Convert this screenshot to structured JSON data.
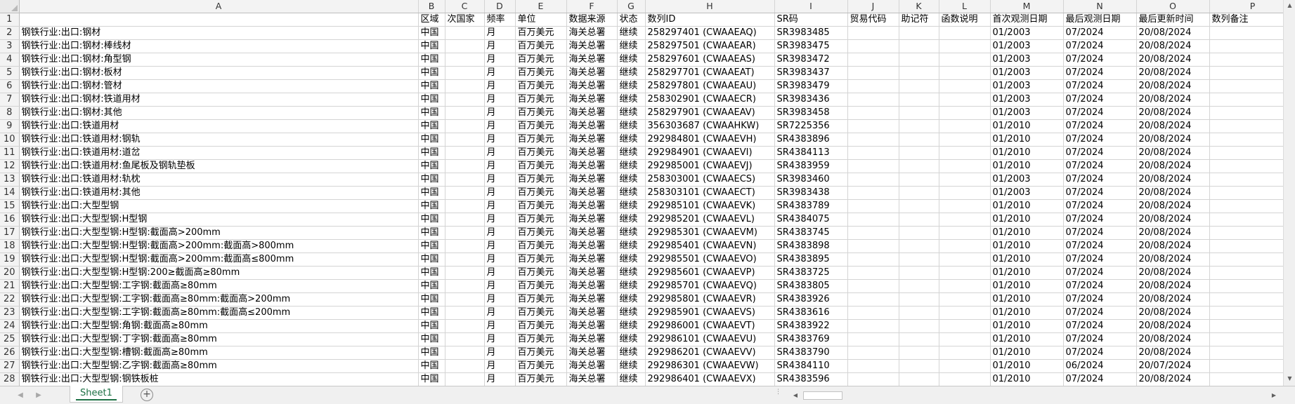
{
  "sheet": {
    "columns": [
      "A",
      "B",
      "C",
      "D",
      "E",
      "F",
      "G",
      "H",
      "I",
      "J",
      "K",
      "L",
      "M",
      "N",
      "O",
      "P"
    ],
    "row_numbers": [
      "1",
      "2",
      "3",
      "4",
      "5",
      "6",
      "7",
      "8",
      "9",
      "10",
      "11",
      "12",
      "13",
      "14",
      "15",
      "16",
      "17",
      "18",
      "19",
      "20",
      "21",
      "22",
      "23",
      "24",
      "25",
      "26",
      "27",
      "28"
    ],
    "rows": [
      [
        "",
        "区域",
        "次国家",
        "频率",
        "单位",
        "数据来源",
        "状态",
        "数列ID",
        "SR码",
        "贸易代码",
        "助记符",
        "函数说明",
        "首次观测日期",
        "最后观测日期",
        "最后更新时间",
        "数列备注"
      ],
      [
        "钢铁行业:出口:钢材",
        "中国",
        "",
        "月",
        "百万美元",
        "海关总署",
        "继续",
        "258297401 (CWAAEAQ)",
        "SR3983485",
        "",
        "",
        "",
        "01/2003",
        "07/2024",
        "20/08/2024",
        ""
      ],
      [
        "钢铁行业:出口:钢材:棒线材",
        "中国",
        "",
        "月",
        "百万美元",
        "海关总署",
        "继续",
        "258297501 (CWAAEAR)",
        "SR3983475",
        "",
        "",
        "",
        "01/2003",
        "07/2024",
        "20/08/2024",
        ""
      ],
      [
        "钢铁行业:出口:钢材:角型钢",
        "中国",
        "",
        "月",
        "百万美元",
        "海关总署",
        "继续",
        "258297601 (CWAAEAS)",
        "SR3983472",
        "",
        "",
        "",
        "01/2003",
        "07/2024",
        "20/08/2024",
        ""
      ],
      [
        "钢铁行业:出口:钢材:板材",
        "中国",
        "",
        "月",
        "百万美元",
        "海关总署",
        "继续",
        "258297701 (CWAAEAT)",
        "SR3983437",
        "",
        "",
        "",
        "01/2003",
        "07/2024",
        "20/08/2024",
        ""
      ],
      [
        "钢铁行业:出口:钢材:管材",
        "中国",
        "",
        "月",
        "百万美元",
        "海关总署",
        "继续",
        "258297801 (CWAAEAU)",
        "SR3983479",
        "",
        "",
        "",
        "01/2003",
        "07/2024",
        "20/08/2024",
        ""
      ],
      [
        "钢铁行业:出口:钢材:铁道用材",
        "中国",
        "",
        "月",
        "百万美元",
        "海关总署",
        "继续",
        "258302901 (CWAAECR)",
        "SR3983436",
        "",
        "",
        "",
        "01/2003",
        "07/2024",
        "20/08/2024",
        ""
      ],
      [
        "钢铁行业:出口:钢材:其他",
        "中国",
        "",
        "月",
        "百万美元",
        "海关总署",
        "继续",
        "258297901 (CWAAEAV)",
        "SR3983458",
        "",
        "",
        "",
        "01/2003",
        "07/2024",
        "20/08/2024",
        ""
      ],
      [
        "钢铁行业:出口:铁道用材",
        "中国",
        "",
        "月",
        "百万美元",
        "海关总署",
        "继续",
        "356303687 (CWAAHKW)",
        "SR7225356",
        "",
        "",
        "",
        "01/2010",
        "07/2024",
        "20/08/2024",
        ""
      ],
      [
        "钢铁行业:出口:铁道用材:钢轨",
        "中国",
        "",
        "月",
        "百万美元",
        "海关总署",
        "继续",
        "292984801 (CWAAEVH)",
        "SR4383896",
        "",
        "",
        "",
        "01/2010",
        "07/2024",
        "20/08/2024",
        ""
      ],
      [
        "钢铁行业:出口:铁道用材:道岔",
        "中国",
        "",
        "月",
        "百万美元",
        "海关总署",
        "继续",
        "292984901 (CWAAEVI)",
        "SR4384113",
        "",
        "",
        "",
        "01/2010",
        "07/2024",
        "20/08/2024",
        ""
      ],
      [
        "钢铁行业:出口:铁道用材:鱼尾板及钢轨垫板",
        "中国",
        "",
        "月",
        "百万美元",
        "海关总署",
        "继续",
        "292985001 (CWAAEVJ)",
        "SR4383959",
        "",
        "",
        "",
        "01/2010",
        "07/2024",
        "20/08/2024",
        ""
      ],
      [
        "钢铁行业:出口:铁道用材:轨枕",
        "中国",
        "",
        "月",
        "百万美元",
        "海关总署",
        "继续",
        "258303001 (CWAAECS)",
        "SR3983460",
        "",
        "",
        "",
        "01/2003",
        "07/2024",
        "20/08/2024",
        ""
      ],
      [
        "钢铁行业:出口:铁道用材:其他",
        "中国",
        "",
        "月",
        "百万美元",
        "海关总署",
        "继续",
        "258303101 (CWAAECT)",
        "SR3983438",
        "",
        "",
        "",
        "01/2003",
        "07/2024",
        "20/08/2024",
        ""
      ],
      [
        "钢铁行业:出口:大型型钢",
        "中国",
        "",
        "月",
        "百万美元",
        "海关总署",
        "继续",
        "292985101 (CWAAEVK)",
        "SR4383789",
        "",
        "",
        "",
        "01/2010",
        "07/2024",
        "20/08/2024",
        ""
      ],
      [
        "钢铁行业:出口:大型型钢:H型钢",
        "中国",
        "",
        "月",
        "百万美元",
        "海关总署",
        "继续",
        "292985201 (CWAAEVL)",
        "SR4384075",
        "",
        "",
        "",
        "01/2010",
        "07/2024",
        "20/08/2024",
        ""
      ],
      [
        "钢铁行业:出口:大型型钢:H型钢:截面高>200mm",
        "中国",
        "",
        "月",
        "百万美元",
        "海关总署",
        "继续",
        "292985301 (CWAAEVM)",
        "SR4383745",
        "",
        "",
        "",
        "01/2010",
        "07/2024",
        "20/08/2024",
        ""
      ],
      [
        "钢铁行业:出口:大型型钢:H型钢:截面高>200mm:截面高>800mm",
        "中国",
        "",
        "月",
        "百万美元",
        "海关总署",
        "继续",
        "292985401 (CWAAEVN)",
        "SR4383898",
        "",
        "",
        "",
        "01/2010",
        "07/2024",
        "20/08/2024",
        ""
      ],
      [
        "钢铁行业:出口:大型型钢:H型钢:截面高>200mm:截面高≤800mm",
        "中国",
        "",
        "月",
        "百万美元",
        "海关总署",
        "继续",
        "292985501 (CWAAEVO)",
        "SR4383895",
        "",
        "",
        "",
        "01/2010",
        "07/2024",
        "20/08/2024",
        ""
      ],
      [
        "钢铁行业:出口:大型型钢:H型钢:200≥截面高≥80mm",
        "中国",
        "",
        "月",
        "百万美元",
        "海关总署",
        "继续",
        "292985601 (CWAAEVP)",
        "SR4383725",
        "",
        "",
        "",
        "01/2010",
        "07/2024",
        "20/08/2024",
        ""
      ],
      [
        "钢铁行业:出口:大型型钢:工字钢:截面高≥80mm",
        "中国",
        "",
        "月",
        "百万美元",
        "海关总署",
        "继续",
        "292985701 (CWAAEVQ)",
        "SR4383805",
        "",
        "",
        "",
        "01/2010",
        "07/2024",
        "20/08/2024",
        ""
      ],
      [
        "钢铁行业:出口:大型型钢:工字钢:截面高≥80mm:截面高>200mm",
        "中国",
        "",
        "月",
        "百万美元",
        "海关总署",
        "继续",
        "292985801 (CWAAEVR)",
        "SR4383926",
        "",
        "",
        "",
        "01/2010",
        "07/2024",
        "20/08/2024",
        ""
      ],
      [
        "钢铁行业:出口:大型型钢:工字钢:截面高≥80mm:截面高≤200mm",
        "中国",
        "",
        "月",
        "百万美元",
        "海关总署",
        "继续",
        "292985901 (CWAAEVS)",
        "SR4383616",
        "",
        "",
        "",
        "01/2010",
        "07/2024",
        "20/08/2024",
        ""
      ],
      [
        "钢铁行业:出口:大型型钢:角钢:截面高≥80mm",
        "中国",
        "",
        "月",
        "百万美元",
        "海关总署",
        "继续",
        "292986001 (CWAAEVT)",
        "SR4383922",
        "",
        "",
        "",
        "01/2010",
        "07/2024",
        "20/08/2024",
        ""
      ],
      [
        "钢铁行业:出口:大型型钢:丁字钢:截面高≥80mm",
        "中国",
        "",
        "月",
        "百万美元",
        "海关总署",
        "继续",
        "292986101 (CWAAEVU)",
        "SR4383769",
        "",
        "",
        "",
        "01/2010",
        "07/2024",
        "20/08/2024",
        ""
      ],
      [
        "钢铁行业:出口:大型型钢:槽钢:截面高≥80mm",
        "中国",
        "",
        "月",
        "百万美元",
        "海关总署",
        "继续",
        "292986201 (CWAAEVV)",
        "SR4383790",
        "",
        "",
        "",
        "01/2010",
        "07/2024",
        "20/08/2024",
        ""
      ],
      [
        "钢铁行业:出口:大型型钢:乙字钢:截面高≥80mm",
        "中国",
        "",
        "月",
        "百万美元",
        "海关总署",
        "继续",
        "292986301 (CWAAEVW)",
        "SR4384110",
        "",
        "",
        "",
        "01/2010",
        "06/2024",
        "20/07/2024",
        ""
      ],
      [
        "钢铁行业:出口:大型型钢:钢铁板桩",
        "中国",
        "",
        "月",
        "百万美元",
        "海关总署",
        "继续",
        "292986401 (CWAAEVX)",
        "SR4383596",
        "",
        "",
        "",
        "01/2010",
        "07/2024",
        "20/08/2024",
        ""
      ]
    ]
  },
  "footer": {
    "sheet_tab": "Sheet1",
    "add_sheet": "+",
    "prev_sheet_icon": "◀",
    "next_sheet_icon": "▶"
  },
  "icons": {
    "scroll_up": "▲",
    "scroll_down": "▼",
    "scroll_left": "◀",
    "scroll_right": "▶",
    "split_handle": "⋮"
  },
  "colors": {
    "tab_accent": "#1e7145",
    "header_bg": "#f3f3f3",
    "grid_line": "#d4d4d4"
  }
}
